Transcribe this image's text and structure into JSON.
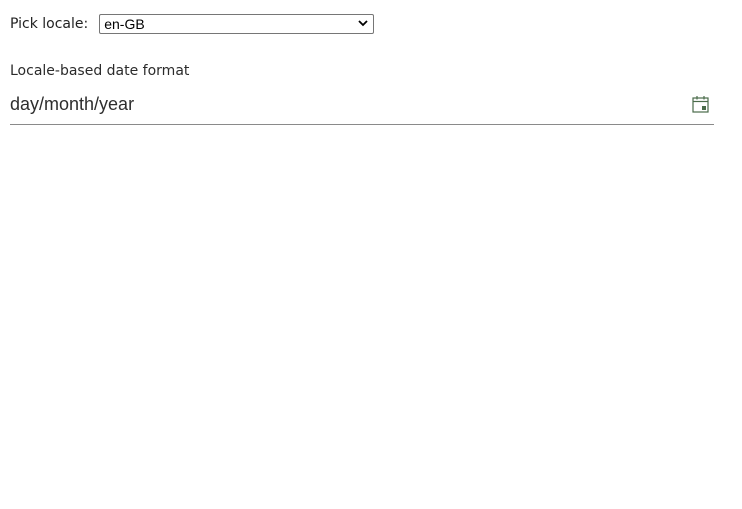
{
  "locale_picker": {
    "label": "Pick locale:",
    "selected": "en-GB",
    "icon": "chevron-down-icon"
  },
  "date_field": {
    "label": "Locale-based date format",
    "value": "day/month/year",
    "icon": "calendar-icon"
  },
  "colors": {
    "calendar_icon": "#4a6b4a",
    "underline": "#8a8a8a"
  }
}
